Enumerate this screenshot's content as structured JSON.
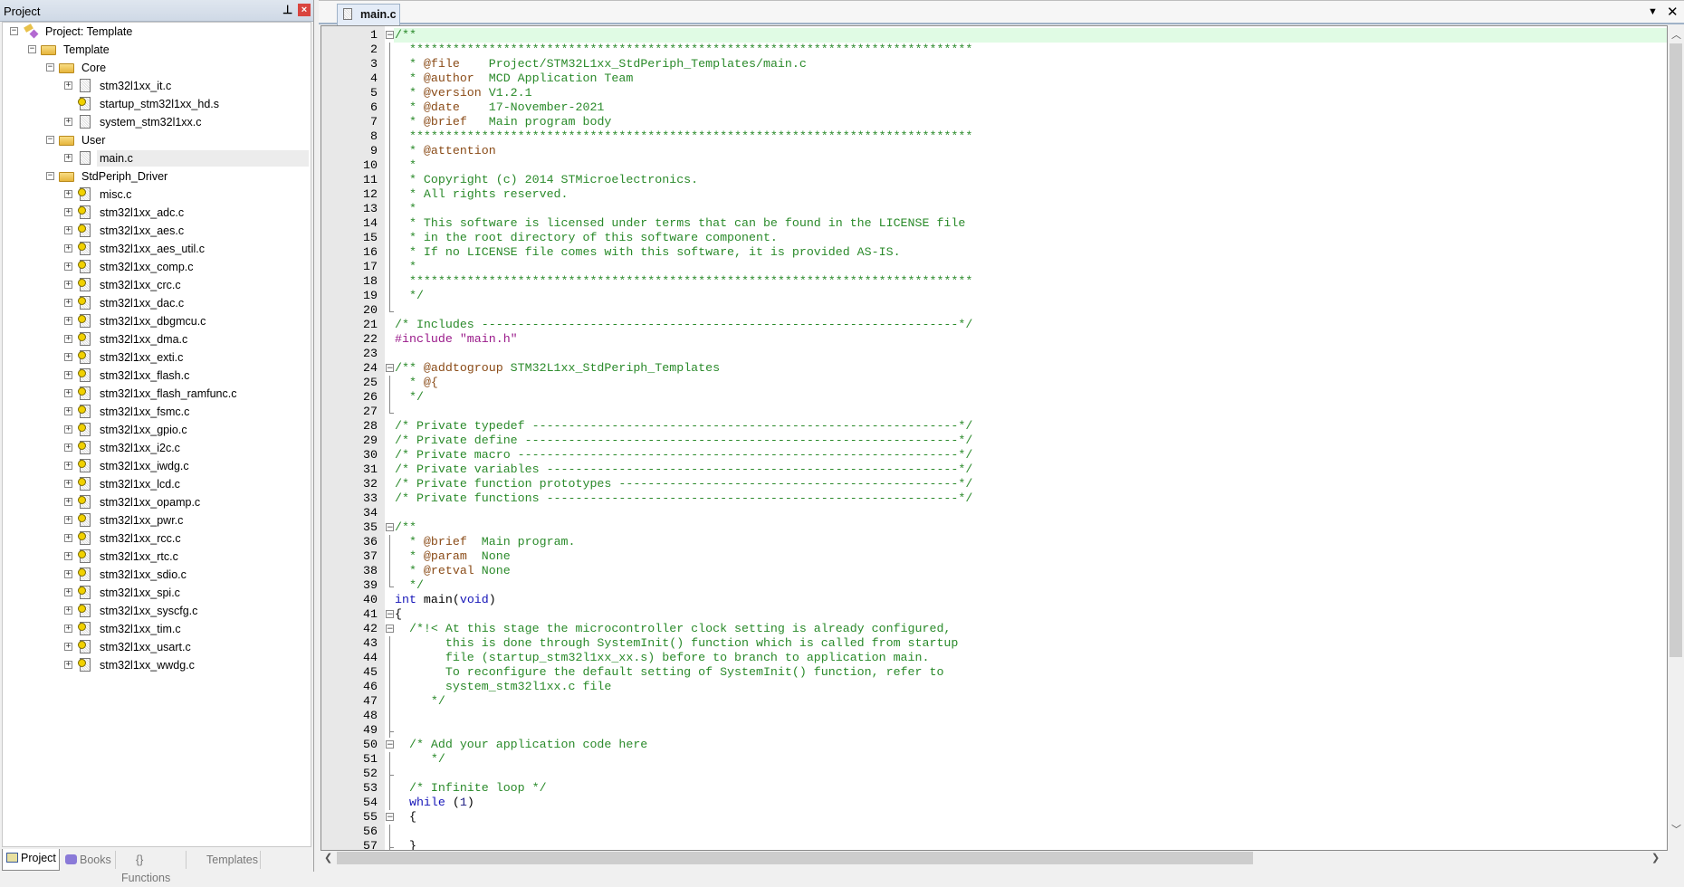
{
  "project_panel": {
    "title": "Project",
    "pin_icon": "pin-icon",
    "close_icon": "close-icon",
    "tree": [
      {
        "label": "Project: Template",
        "level": 0,
        "icon": "project-icon",
        "expander": "minus"
      },
      {
        "label": "Template",
        "level": 1,
        "icon": "target-folder-icon",
        "expander": "minus"
      },
      {
        "label": "Core",
        "level": 2,
        "icon": "folder-icon",
        "expander": "minus"
      },
      {
        "label": "stm32l1xx_it.c",
        "level": 3,
        "icon": "file-icon",
        "expander": "plus"
      },
      {
        "label": "startup_stm32l1xx_hd.s",
        "level": 3,
        "icon": "file-key-icon",
        "expander": "none"
      },
      {
        "label": "system_stm32l1xx.c",
        "level": 3,
        "icon": "file-icon",
        "expander": "plus"
      },
      {
        "label": "User",
        "level": 2,
        "icon": "folder-icon",
        "expander": "minus"
      },
      {
        "label": "main.c",
        "level": 3,
        "icon": "file-icon",
        "expander": "plus",
        "selected": true
      },
      {
        "label": "StdPeriph_Driver",
        "level": 2,
        "icon": "folder-icon",
        "expander": "minus"
      },
      {
        "label": "misc.c",
        "level": 3,
        "icon": "file-key-icon",
        "expander": "plus"
      },
      {
        "label": "stm32l1xx_adc.c",
        "level": 3,
        "icon": "file-key-icon",
        "expander": "plus"
      },
      {
        "label": "stm32l1xx_aes.c",
        "level": 3,
        "icon": "file-key-icon",
        "expander": "plus"
      },
      {
        "label": "stm32l1xx_aes_util.c",
        "level": 3,
        "icon": "file-key-icon",
        "expander": "plus"
      },
      {
        "label": "stm32l1xx_comp.c",
        "level": 3,
        "icon": "file-key-icon",
        "expander": "plus"
      },
      {
        "label": "stm32l1xx_crc.c",
        "level": 3,
        "icon": "file-key-icon",
        "expander": "plus"
      },
      {
        "label": "stm32l1xx_dac.c",
        "level": 3,
        "icon": "file-key-icon",
        "expander": "plus"
      },
      {
        "label": "stm32l1xx_dbgmcu.c",
        "level": 3,
        "icon": "file-key-icon",
        "expander": "plus"
      },
      {
        "label": "stm32l1xx_dma.c",
        "level": 3,
        "icon": "file-key-icon",
        "expander": "plus"
      },
      {
        "label": "stm32l1xx_exti.c",
        "level": 3,
        "icon": "file-key-icon",
        "expander": "plus"
      },
      {
        "label": "stm32l1xx_flash.c",
        "level": 3,
        "icon": "file-key-icon",
        "expander": "plus"
      },
      {
        "label": "stm32l1xx_flash_ramfunc.c",
        "level": 3,
        "icon": "file-key-icon",
        "expander": "plus"
      },
      {
        "label": "stm32l1xx_fsmc.c",
        "level": 3,
        "icon": "file-key-icon",
        "expander": "plus"
      },
      {
        "label": "stm32l1xx_gpio.c",
        "level": 3,
        "icon": "file-key-icon",
        "expander": "plus"
      },
      {
        "label": "stm32l1xx_i2c.c",
        "level": 3,
        "icon": "file-key-icon",
        "expander": "plus"
      },
      {
        "label": "stm32l1xx_iwdg.c",
        "level": 3,
        "icon": "file-key-icon",
        "expander": "plus"
      },
      {
        "label": "stm32l1xx_lcd.c",
        "level": 3,
        "icon": "file-key-icon",
        "expander": "plus"
      },
      {
        "label": "stm32l1xx_opamp.c",
        "level": 3,
        "icon": "file-key-icon",
        "expander": "plus"
      },
      {
        "label": "stm32l1xx_pwr.c",
        "level": 3,
        "icon": "file-key-icon",
        "expander": "plus"
      },
      {
        "label": "stm32l1xx_rcc.c",
        "level": 3,
        "icon": "file-key-icon",
        "expander": "plus"
      },
      {
        "label": "stm32l1xx_rtc.c",
        "level": 3,
        "icon": "file-key-icon",
        "expander": "plus"
      },
      {
        "label": "stm32l1xx_sdio.c",
        "level": 3,
        "icon": "file-key-icon",
        "expander": "plus"
      },
      {
        "label": "stm32l1xx_spi.c",
        "level": 3,
        "icon": "file-key-icon",
        "expander": "plus"
      },
      {
        "label": "stm32l1xx_syscfg.c",
        "level": 3,
        "icon": "file-key-icon",
        "expander": "plus"
      },
      {
        "label": "stm32l1xx_tim.c",
        "level": 3,
        "icon": "file-key-icon",
        "expander": "plus"
      },
      {
        "label": "stm32l1xx_usart.c",
        "level": 3,
        "icon": "file-key-icon",
        "expander": "plus"
      },
      {
        "label": "stm32l1xx_wwdg.c",
        "level": 3,
        "icon": "file-key-icon",
        "expander": "plus"
      }
    ],
    "bottom_tabs": [
      {
        "label": "Project",
        "icon": "project-tab-icon",
        "active": true
      },
      {
        "label": "Books",
        "icon": "books-icon"
      },
      {
        "label": "{} Functions",
        "icon": "functions-icon"
      },
      {
        "label": "Templates",
        "icon": "templates-icon"
      }
    ]
  },
  "editor": {
    "tab": {
      "label": "main.c",
      "icon": "file-icon"
    },
    "dropdown_icon": "triangle-down-icon",
    "close_icon": "close-icon",
    "current_line": 1,
    "colors": {
      "comment": "#2a8a2a",
      "doc_tag": "#8a4b17",
      "keyword": "#1515b8",
      "string": "#9a1a8a",
      "current_line_bg": "#e0fbe4"
    },
    "lines": [
      [
        [
          "c",
          "/**"
        ]
      ],
      [
        [
          "c",
          "  ******************************************************************************"
        ]
      ],
      [
        [
          "c",
          "  * "
        ],
        [
          "tg",
          "@file"
        ],
        [
          "c",
          "    Project/STM32L1xx_StdPeriph_Templates/main.c"
        ]
      ],
      [
        [
          "c",
          "  * "
        ],
        [
          "tg",
          "@author"
        ],
        [
          "c",
          "  MCD Application Team"
        ]
      ],
      [
        [
          "c",
          "  * "
        ],
        [
          "tg",
          "@version"
        ],
        [
          "c",
          " V1.2.1"
        ]
      ],
      [
        [
          "c",
          "  * "
        ],
        [
          "tg",
          "@date"
        ],
        [
          "c",
          "    17-November-2021"
        ]
      ],
      [
        [
          "c",
          "  * "
        ],
        [
          "tg",
          "@brief"
        ],
        [
          "c",
          "   Main program body"
        ]
      ],
      [
        [
          "c",
          "  ******************************************************************************"
        ]
      ],
      [
        [
          "c",
          "  * "
        ],
        [
          "tg",
          "@attention"
        ]
      ],
      [
        [
          "c",
          "  *"
        ]
      ],
      [
        [
          "c",
          "  * Copyright (c) 2014 STMicroelectronics."
        ]
      ],
      [
        [
          "c",
          "  * All rights reserved."
        ]
      ],
      [
        [
          "c",
          "  *"
        ]
      ],
      [
        [
          "c",
          "  * This software is licensed under terms that can be found in the LICENSE file"
        ]
      ],
      [
        [
          "c",
          "  * in the root directory of this software component."
        ]
      ],
      [
        [
          "c",
          "  * If no LICENSE file comes with this software, it is provided AS-IS."
        ]
      ],
      [
        [
          "c",
          "  *"
        ]
      ],
      [
        [
          "c",
          "  ******************************************************************************"
        ]
      ],
      [
        [
          "c",
          "  */"
        ]
      ],
      [],
      [
        [
          "c",
          "/* Includes ------------------------------------------------------------------*/"
        ]
      ],
      [
        [
          "p",
          "#include "
        ],
        [
          "s",
          "\"main.h\""
        ]
      ],
      [],
      [
        [
          "c",
          "/** "
        ],
        [
          "tg",
          "@addtogroup"
        ],
        [
          "c",
          " STM32L1xx_StdPeriph_Templates"
        ]
      ],
      [
        [
          "c",
          "  * "
        ],
        [
          "tg",
          "@{"
        ]
      ],
      [
        [
          "c",
          "  */"
        ]
      ],
      [],
      [
        [
          "c",
          "/* Private typedef -----------------------------------------------------------*/"
        ]
      ],
      [
        [
          "c",
          "/* Private define ------------------------------------------------------------*/"
        ]
      ],
      [
        [
          "c",
          "/* Private macro -------------------------------------------------------------*/"
        ]
      ],
      [
        [
          "c",
          "/* Private variables ---------------------------------------------------------*/"
        ]
      ],
      [
        [
          "c",
          "/* Private function prototypes -----------------------------------------------*/"
        ]
      ],
      [
        [
          "c",
          "/* Private functions ---------------------------------------------------------*/"
        ]
      ],
      [],
      [
        [
          "c",
          "/**"
        ]
      ],
      [
        [
          "c",
          "  * "
        ],
        [
          "tg",
          "@brief"
        ],
        [
          "c",
          "  Main program."
        ]
      ],
      [
        [
          "c",
          "  * "
        ],
        [
          "tg",
          "@param"
        ],
        [
          "c",
          "  None"
        ]
      ],
      [
        [
          "c",
          "  * "
        ],
        [
          "tg",
          "@retval"
        ],
        [
          "c",
          " None"
        ]
      ],
      [
        [
          "c",
          "  */"
        ]
      ],
      [
        [
          "k",
          "int"
        ],
        [
          "d",
          " main"
        ],
        [
          "d",
          "("
        ],
        [
          "k",
          "void"
        ],
        [
          "d",
          ")"
        ]
      ],
      [
        [
          "d",
          "{"
        ]
      ],
      [
        [
          "c",
          "  /*!< At this stage the microcontroller clock setting is already configured,"
        ]
      ],
      [
        [
          "c",
          "       this is done through SystemInit() function which is called from startup"
        ]
      ],
      [
        [
          "c",
          "       file (startup_stm32l1xx_xx.s) before to branch to application main."
        ]
      ],
      [
        [
          "c",
          "       To reconfigure the default setting of SystemInit() function, refer to"
        ]
      ],
      [
        [
          "c",
          "       system_stm32l1xx.c file"
        ]
      ],
      [
        [
          "c",
          "     */"
        ]
      ],
      [],
      [],
      [
        [
          "c",
          "  /* Add your application code here"
        ]
      ],
      [
        [
          "c",
          "     */"
        ]
      ],
      [],
      [
        [
          "c",
          "  /* Infinite loop */"
        ]
      ],
      [
        [
          "k",
          "  while"
        ],
        [
          "d",
          " ("
        ],
        [
          "n",
          "1"
        ],
        [
          "d",
          ")"
        ]
      ],
      [
        [
          "d",
          "  {"
        ]
      ],
      [],
      [
        [
          "d",
          "  }"
        ]
      ]
    ]
  }
}
